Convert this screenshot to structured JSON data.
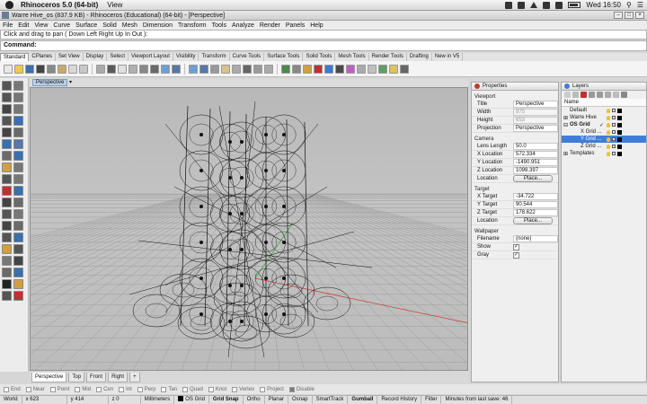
{
  "macbar": {
    "app_name": "Rhinoceros 5.0 (64-bit)",
    "menu_item": "View",
    "clock": "Wed 16:50"
  },
  "window": {
    "title": "Warre Hive_os (837.9 KB) - Rhinoceros (Educational) (64-bit) - [Perspective]"
  },
  "menu": [
    "File",
    "Edit",
    "View",
    "Curve",
    "Surface",
    "Solid",
    "Mesh",
    "Dimension",
    "Transform",
    "Tools",
    "Analyze",
    "Render",
    "Panels",
    "Help"
  ],
  "command": {
    "history_text": "Click and drag to pan ( Down  Left  Right  Up  In  Out ):",
    "prompt_label": "Command:",
    "value": ""
  },
  "toolbar_tabs": [
    {
      "label": "Standard",
      "active": true
    },
    {
      "label": "CPlanes"
    },
    {
      "label": "Set View"
    },
    {
      "label": "Display"
    },
    {
      "label": "Select"
    },
    {
      "label": "Viewport Layout"
    },
    {
      "label": "Visibility"
    },
    {
      "label": "Transform"
    },
    {
      "label": "Curve Tools"
    },
    {
      "label": "Surface Tools"
    },
    {
      "label": "Solid Tools"
    },
    {
      "label": "Mesh Tools"
    },
    {
      "label": "Render Tools"
    },
    {
      "label": "Drafting"
    },
    {
      "label": "New in V5"
    }
  ],
  "toolbar_icon_colors": [
    "#e8e8e8",
    "#f0c850",
    "#3a6fb0",
    "#444",
    "#888",
    "#c9a86a",
    "#d9d9d9",
    "#c8c8c8",
    "#aaa",
    "#5a5a5a",
    "#e0e0e0",
    "#b0b0b0",
    "#888",
    "#6a6a6a",
    "#6aa0d8",
    "#5577aa",
    "#6aa0d8",
    "#5577aa",
    "#999",
    "#d8c28a",
    "#aaa",
    "#666",
    "#999",
    "#aaa",
    "#4a8a4a",
    "#888",
    "#d0a040",
    "#c03030",
    "#3a7ad0",
    "#4a4a4a",
    "#c060c0",
    "#aaa",
    "#c0c0c0",
    "#60a060",
    "#e0c060",
    "#666"
  ],
  "left_toolbar_icon_colors": [
    "#555",
    "#777",
    "#555",
    "#777",
    "#444",
    "#777",
    "#555",
    "#3a6fb0",
    "#444",
    "#6a6a6a",
    "#3a6fb0",
    "#5577aa",
    "#6a6a6a",
    "#3a6fb0",
    "#d0a040",
    "#777",
    "#555",
    "#777",
    "#c03030",
    "#3a6fb0",
    "#444",
    "#6a6a6a",
    "#555",
    "#777",
    "#444",
    "#6a6a6a",
    "#555",
    "#3a6fb0",
    "#d0a040",
    "#555",
    "#777",
    "#444",
    "#6a6a6a",
    "#3a6fb0",
    "#222",
    "#d0a040",
    "#555",
    "#c03030"
  ],
  "viewport": {
    "title": "Perspective",
    "tabs": [
      {
        "label": "Perspective",
        "active": true
      },
      {
        "label": "Top"
      },
      {
        "label": "Front"
      },
      {
        "label": "Right"
      },
      {
        "label": "+"
      }
    ]
  },
  "osnaps": [
    {
      "label": "End",
      "on": false
    },
    {
      "label": "Near",
      "on": false
    },
    {
      "label": "Point",
      "on": false
    },
    {
      "label": "Mid",
      "on": false
    },
    {
      "label": "Cen",
      "on": false
    },
    {
      "label": "Int",
      "on": false
    },
    {
      "label": "Perp",
      "on": false
    },
    {
      "label": "Tan",
      "on": false
    },
    {
      "label": "Quad",
      "on": false
    },
    {
      "label": "Knot",
      "on": false
    },
    {
      "label": "Vertex",
      "on": false
    },
    {
      "label": "Project",
      "on": false
    },
    {
      "label": "Disable",
      "on": true
    }
  ],
  "status": {
    "cplane": "World",
    "x": "x 623",
    "y": "y 414",
    "z": "z 0",
    "units": "Millimeters",
    "layer": "OS Grid",
    "items": [
      "Grid Snap",
      "Ortho",
      "Planar",
      "Osnap",
      "SmartTrack",
      "Gumball",
      "Record History",
      "Filter"
    ],
    "message": "Minutes from last save: 46"
  },
  "properties": {
    "title": "Properties",
    "viewport_section": "Viewport",
    "rows_viewport": [
      {
        "key": "Title",
        "value": "Perspective"
      },
      {
        "key": "Width",
        "value": "975",
        "disabled": true
      },
      {
        "key": "Height",
        "value": "653",
        "disabled": true
      },
      {
        "key": "Projection",
        "value": "Perspective"
      }
    ],
    "camera_section": "Camera",
    "rows_camera": [
      {
        "key": "Lens Length",
        "value": "50.0"
      },
      {
        "key": "X Location",
        "value": "572.334"
      },
      {
        "key": "Y Location",
        "value": "-1490.951"
      },
      {
        "key": "Z Location",
        "value": "1098.397"
      },
      {
        "key": "Location",
        "button": "Place..."
      }
    ],
    "target_section": "Target",
    "rows_target": [
      {
        "key": "X Target",
        "value": "-34.722"
      },
      {
        "key": "Y Target",
        "value": "90.544"
      },
      {
        "key": "Z Target",
        "value": "178.622"
      },
      {
        "key": "Location",
        "button": "Place..."
      }
    ],
    "wallpaper_section": "Wallpaper",
    "rows_wallpaper": [
      {
        "key": "Filename",
        "value": "(none)"
      },
      {
        "key": "Show",
        "check": "✓"
      },
      {
        "key": "Gray",
        "check": "✓"
      }
    ]
  },
  "layers": {
    "title": "Layers",
    "column_name": "Name",
    "rows": [
      {
        "name": "Default",
        "indent": 0,
        "expander": "",
        "bold": false,
        "swatch": "#000000"
      },
      {
        "name": "Warre Hive",
        "indent": 0,
        "expander": "⊞",
        "bold": false,
        "swatch": "#000000"
      },
      {
        "name": "OS Grid",
        "indent": 0,
        "expander": "⊟",
        "bold": true,
        "current": "✓",
        "swatch": "#000000"
      },
      {
        "name": "X Grid ...",
        "indent": 2,
        "expander": "",
        "bold": false,
        "swatch": "#000000"
      },
      {
        "name": "Y Grid ...",
        "indent": 2,
        "expander": "",
        "bold": false,
        "selected": true,
        "swatch": "#000000"
      },
      {
        "name": "Z Grid ...",
        "indent": 2,
        "expander": "",
        "bold": false,
        "swatch": "#000000"
      },
      {
        "name": "Templates",
        "indent": 0,
        "expander": "⊞",
        "bold": false,
        "swatch": "#000000"
      }
    ]
  },
  "colors": {
    "grid_line": "#9c9c9c",
    "axis_x": "#c84040",
    "axis_y": "#3fae3f",
    "geometry": "#111111",
    "selection": "#3f7ed8"
  }
}
